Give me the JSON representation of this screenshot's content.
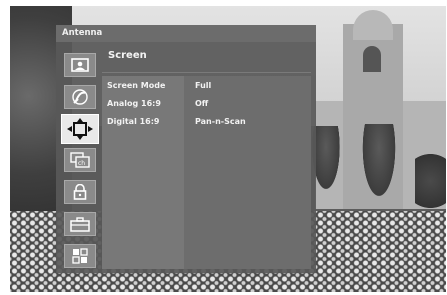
{
  "menu": {
    "header": "Antenna",
    "title": "Screen",
    "sidebar_icons": [
      {
        "name": "picture-icon",
        "active": false
      },
      {
        "name": "audio-icon",
        "active": false
      },
      {
        "name": "screen-icon",
        "active": true
      },
      {
        "name": "channel-icon",
        "active": false
      },
      {
        "name": "lock-icon",
        "active": false
      },
      {
        "name": "setup-icon",
        "active": false
      },
      {
        "name": "apps-icon",
        "active": false
      }
    ],
    "settings": [
      {
        "label": "Screen Mode",
        "value": "Full"
      },
      {
        "label": "Analog 16:9",
        "value": "Off"
      },
      {
        "label": "Digital 16:9",
        "value": "Pan-n-Scan"
      }
    ]
  }
}
